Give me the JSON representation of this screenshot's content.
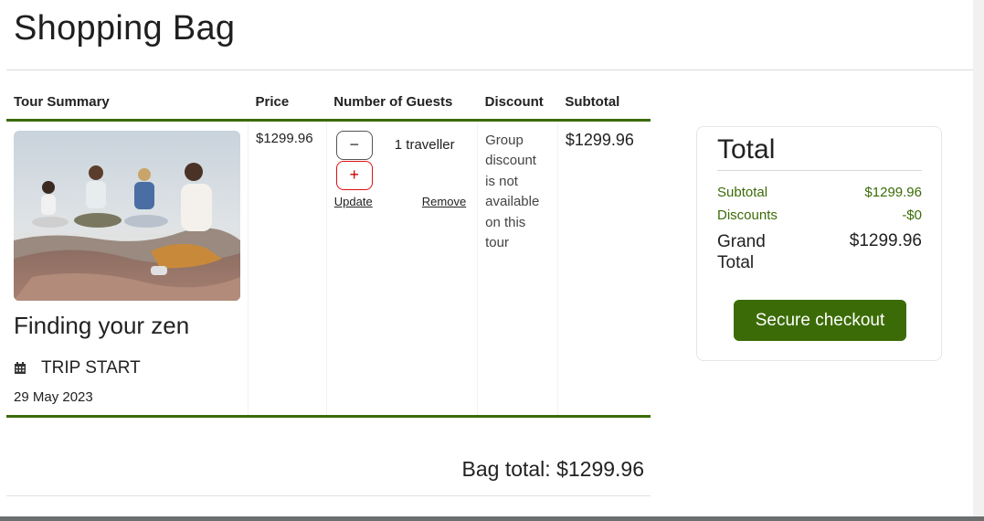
{
  "page": {
    "title": "Shopping Bag"
  },
  "table": {
    "headers": {
      "summary": "Tour Summary",
      "price": "Price",
      "guests": "Number of Guests",
      "discount": "Discount",
      "subtotal": "Subtotal"
    },
    "item": {
      "tour_name": "Finding your zen",
      "trip_start_label": "TRIP START",
      "trip_date": "29 May 2023",
      "price": "$1299.96",
      "decrement_symbol": "−",
      "increment_symbol": "+",
      "travellers": "1 traveller",
      "update_label": "Update",
      "remove_label": "Remove",
      "discount_text": "Group discount is not available on this tour",
      "subtotal": "$1299.96"
    }
  },
  "bag_total": "Bag total: $1299.96",
  "summary_card": {
    "title": "Total",
    "subtotal_label": "Subtotal",
    "subtotal_value": "$1299.96",
    "discounts_label": "Discounts",
    "discounts_value": "-$0",
    "grand_total_label": "Grand Total",
    "grand_total_value": "$1299.96",
    "checkout_label": "Secure checkout"
  },
  "colors": {
    "accent_green": "#3b6b06",
    "remove_red": "#cc0000"
  },
  "icons": {
    "calendar": "calendar-icon"
  }
}
